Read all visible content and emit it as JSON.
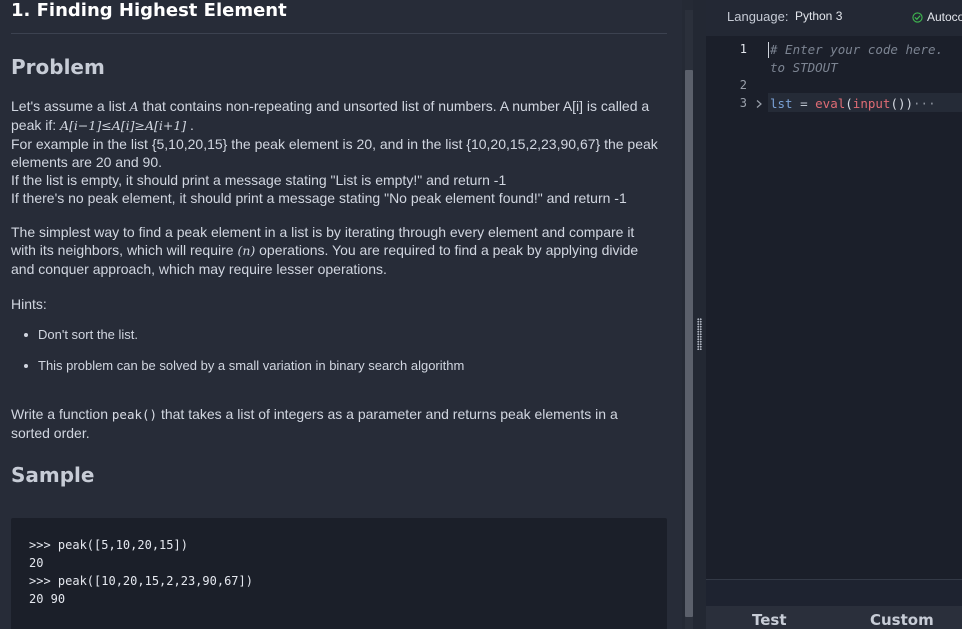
{
  "problem": {
    "title": "1. Finding Highest Element",
    "heading_problem": "Problem",
    "intro_line1_pre": "Let's assume a list ",
    "intro_line1_var": "A",
    "intro_line1_post": " that contains non-repeating and unsorted list of numbers. A number A[i] is called a",
    "intro_line2_pre": "peak if: ",
    "intro_line2_math": "A[i−1]≤A[i]≥A[i+1]",
    "intro_line2_post": " .",
    "example_line1": "For example in the list {5,10,20,15} the peak element is 20, and in the list {10,20,15,2,23,90,67} the peak",
    "example_line2": "elements are 20 and 90.",
    "empty_rule": "If the list is empty, it should print a message stating \"List is empty!\" and return -1",
    "nopeak_rule": "If there's no peak element, it should print a message stating \"No peak element found!\" and return -1",
    "simple_line1": "The simplest way to find a peak element in a list is by iterating through every element and compare it",
    "simple_line2_pre": "with its neighbors, which will require ",
    "simple_line2_math": "(n)",
    "simple_line2_post": " operations. You are required to find a peak by applying divide",
    "simple_line3": "and conquer approach, which may require lesser operations.",
    "hints_label": "Hints:",
    "hints": [
      "Don't sort the list.",
      "This problem can be solved by a small variation in binary search algorithm"
    ],
    "write_line1_pre": "Write a function ",
    "write_line1_code": "peak()",
    "write_line1_post": " that takes a list of integers as a parameter and returns peak elements in a",
    "write_line2": "sorted order.",
    "heading_sample": "Sample",
    "sample_lines": [
      ">>> peak([5,10,20,15])",
      "20",
      ">>> peak([10,20,15,2,23,90,67])",
      "20 90"
    ]
  },
  "editor": {
    "language_label": "Language:",
    "language_value": "Python 3",
    "autocomplete_label": "Autoco",
    "line_numbers": [
      "1",
      "2",
      "3"
    ],
    "comment_line1": "# Enter your code here.",
    "comment_line2": "to STDOUT",
    "code_var": "lst",
    "code_op": " = ",
    "code_fn1": "eval",
    "code_paren1": "(",
    "code_fn2": "input",
    "code_paren2": "())",
    "code_ellipsis": "···",
    "buttons": {
      "test": "Test",
      "custom": "Custom"
    }
  },
  "colors": {
    "panel_bg": "#272c38",
    "editor_bg": "#1b1f2a",
    "keyword_red": "#e06c75",
    "variable_blue": "#7aa2d6",
    "check_green": "#3fb950"
  },
  "icons": [
    "check-circle-icon",
    "fold-chevron-icon",
    "splitter-grip-icon"
  ]
}
